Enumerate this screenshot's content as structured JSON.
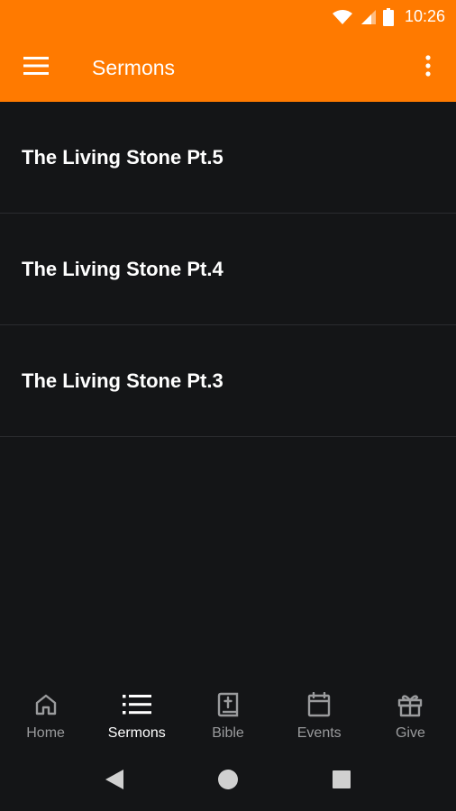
{
  "status_bar": {
    "time": "10:26",
    "icons": [
      "wifi-icon",
      "signal-icon",
      "battery-icon"
    ]
  },
  "app_bar": {
    "title": "Sermons",
    "menu_icon": "hamburger-menu-icon",
    "overflow_icon": "more-vert-icon",
    "color": "#ff7a00"
  },
  "sermons": {
    "items": [
      {
        "title": "The Living Stone Pt.5"
      },
      {
        "title": "The Living Stone Pt.4"
      },
      {
        "title": "The Living Stone Pt.3"
      }
    ]
  },
  "bottom_nav": {
    "items": [
      {
        "label": "Home",
        "icon": "home-icon",
        "active": false
      },
      {
        "label": "Sermons",
        "icon": "list-icon",
        "active": true
      },
      {
        "label": "Bible",
        "icon": "bible-icon",
        "active": false
      },
      {
        "label": "Events",
        "icon": "calendar-icon",
        "active": false
      },
      {
        "label": "Give",
        "icon": "gift-icon",
        "active": false
      }
    ]
  },
  "system_nav": {
    "buttons": [
      "back-icon",
      "home-circle-icon",
      "recents-icon"
    ]
  },
  "colors": {
    "accent": "#ff7a00",
    "background": "#141517",
    "divider": "#2b2c2f",
    "inactive": "#9a9b9d",
    "active": "#ffffff"
  }
}
